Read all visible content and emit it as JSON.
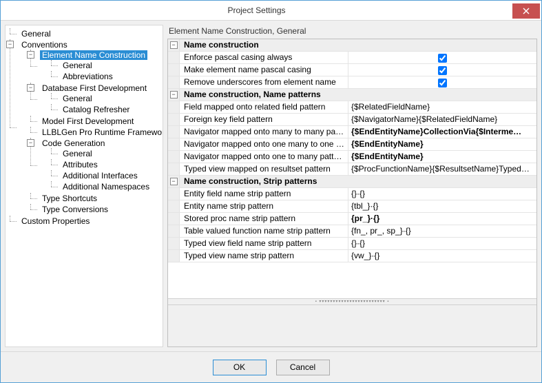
{
  "window": {
    "title": "Project Settings"
  },
  "buttons": {
    "ok": "OK",
    "cancel": "Cancel",
    "close": "×"
  },
  "breadcrumb": "Element Name Construction, General",
  "tree": {
    "general": "General",
    "conventions": "Conventions",
    "elem_name_construction": "Element Name Construction",
    "enc_general": "General",
    "enc_abbrev": "Abbreviations",
    "dbfirst": "Database First Development",
    "dbfirst_general": "General",
    "dbfirst_catalog": "Catalog Refresher",
    "modelfirst": "Model First Development",
    "runtime": "LLBLGen Pro Runtime Framework",
    "codegen": "Code Generation",
    "cg_general": "General",
    "cg_attributes": "Attributes",
    "cg_addl_interfaces": "Additional Interfaces",
    "cg_addl_namespaces": "Additional Namespaces",
    "type_shortcuts": "Type Shortcuts",
    "type_conversions": "Type Conversions",
    "custom_props": "Custom Properties"
  },
  "grid": {
    "cat1": "Name construction",
    "enforce_pascal": {
      "name": "Enforce pascal casing always",
      "value": true
    },
    "make_pascal": {
      "name": "Make element name pascal casing",
      "value": true
    },
    "remove_underscores": {
      "name": "Remove underscores from element name",
      "value": true
    },
    "cat2": "Name construction, Name patterns",
    "field_related": {
      "name": "Field mapped onto related field pattern",
      "value": "{$RelatedFieldName}"
    },
    "fk_field": {
      "name": "Foreign key field pattern",
      "value": "{$NavigatorName}{$RelatedFieldName}"
    },
    "nav_mm": {
      "name": "Navigator mapped onto many to many pattern",
      "value": "{$EndEntityName}CollectionVia{$Interme…",
      "bold": true
    },
    "nav_m1": {
      "name": "Navigator mapped onto one many to one pattern",
      "value": "{$EndEntityName}",
      "bold": true
    },
    "nav_1m": {
      "name": "Navigator mapped onto one to many pattern",
      "value": "{$EndEntityName}",
      "bold": true
    },
    "typedview_rs": {
      "name": "Typed view mapped on resultset pattern",
      "value": "{$ProcFunctionName}{$ResultsetName}TypedView"
    },
    "cat3": "Name construction, Strip patterns",
    "entity_field_strip": {
      "name": "Entity field name strip pattern",
      "value": "{}·{}"
    },
    "entity_strip": {
      "name": "Entity name strip pattern",
      "value": "{tbl_}·{}"
    },
    "sp_strip": {
      "name": "Stored proc name strip pattern",
      "value": "{pr_}·{}",
      "bold": true
    },
    "tvf_strip": {
      "name": "Table valued function name strip pattern",
      "value": "{fn_, pr_, sp_}·{}"
    },
    "tvfield_strip": {
      "name": "Typed view field name strip pattern",
      "value": "{}·{}"
    },
    "tv_strip": {
      "name": "Typed view name strip pattern",
      "value": "{vw_}·{}"
    }
  }
}
